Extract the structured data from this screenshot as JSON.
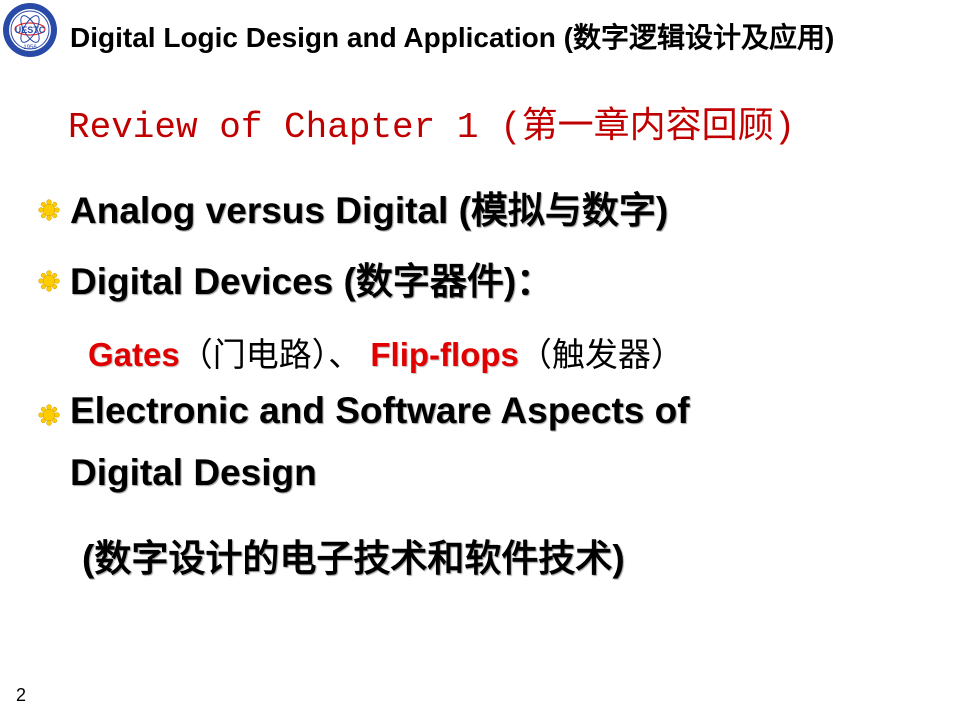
{
  "header": {
    "logo_icon": "university-seal-icon",
    "title": "Digital Logic Design and Application (数字逻辑设计及应用)",
    "logo_text": "UESTC",
    "logo_year": "1956"
  },
  "slide": {
    "title": "Review of Chapter 1 (第一章内容回顾)",
    "bullets": [
      {
        "icon": "sunburst-bullet-icon",
        "text": "Analog versus Digital (模拟与数字)"
      },
      {
        "icon": "sunburst-bullet-icon",
        "text": "Digital Devices (数字器件)："
      },
      {
        "icon": "sunburst-bullet-icon",
        "lines": [
          "Electronic and Software Aspects of",
          "Digital Design"
        ]
      }
    ],
    "sub_items": {
      "gates": "Gates",
      "gates_cn": "（门电路）、",
      "flipflops": "Flip-flops",
      "flipflops_cn": "（触发器）"
    },
    "note": "(数字设计的电子技术和软件技术)",
    "page_number": "2"
  },
  "colors": {
    "title_red": "#c00000",
    "highlight_red": "#e00000",
    "bullet_yellow": "#ffcc00",
    "logo_blue": "#2a4aa8"
  }
}
